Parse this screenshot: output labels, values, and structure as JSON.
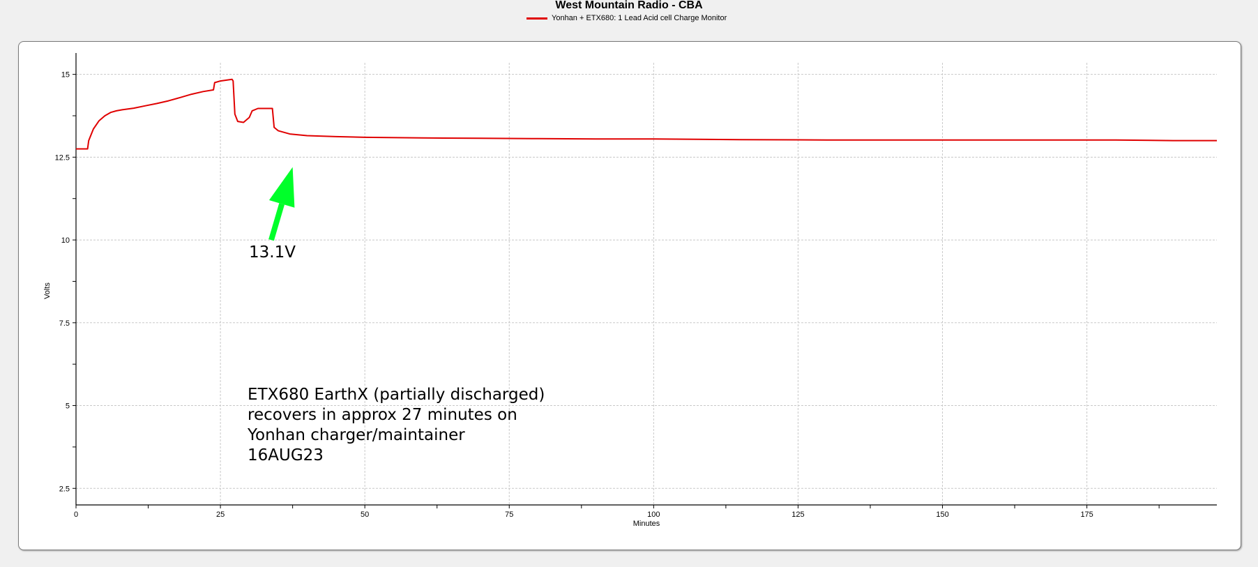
{
  "chart_data": {
    "type": "line",
    "title": "West Mountain Radio - CBA",
    "xlabel": "Minutes",
    "ylabel": "Volts",
    "xlim": [
      0,
      197.5
    ],
    "ylim": [
      2,
      15.35
    ],
    "x_ticks": [
      0,
      25,
      50,
      75,
      100,
      125,
      150,
      175
    ],
    "x_minor_step": 12.5,
    "y_ticks": [
      2.5,
      5,
      7.5,
      10,
      12.5,
      15
    ],
    "y_tick_labels": [
      "2.5",
      "5",
      "7.5",
      "10",
      "12.5",
      "15"
    ],
    "y_minor_step": 1.25,
    "grid": true,
    "legend_position": "top-center",
    "series": [
      {
        "name": "Yonhan + ETX680: 1 Lead Acid cell Charge Monitor",
        "color": "#e00000",
        "x": [
          0,
          2,
          2.2,
          3,
          4,
          5,
          6,
          7,
          8,
          10,
          12,
          14,
          16,
          18,
          20,
          22,
          23.8,
          24,
          25,
          27,
          27.2,
          27.5,
          28,
          29,
          30,
          30.5,
          31.5,
          32,
          34,
          34.3,
          35,
          37,
          40,
          45,
          50,
          60,
          70,
          80,
          90,
          100,
          115,
          130,
          150,
          170,
          180,
          190,
          197.5
        ],
        "y": [
          12.75,
          12.75,
          13.0,
          13.35,
          13.6,
          13.75,
          13.85,
          13.9,
          13.93,
          13.98,
          14.05,
          14.12,
          14.2,
          14.3,
          14.4,
          14.48,
          14.53,
          14.75,
          14.8,
          14.85,
          14.8,
          13.8,
          13.58,
          13.55,
          13.7,
          13.9,
          13.97,
          13.97,
          13.97,
          13.4,
          13.3,
          13.2,
          13.15,
          13.12,
          13.1,
          13.08,
          13.07,
          13.06,
          13.05,
          13.05,
          13.03,
          13.02,
          13.02,
          13.02,
          13.02,
          13.0,
          13.0
        ]
      }
    ],
    "annotations": {
      "arrow_label": "13.1V",
      "arrow_color": "#00ff2a",
      "arrow_from": [
        33.8,
        10.0
      ],
      "arrow_to": [
        37.5,
        12.2
      ],
      "note_lines": [
        "ETX680 EarthX (partially discharged)",
        "recovers in approx 27 minutes on",
        "Yonhan charger/maintainer",
        "16AUG23"
      ]
    }
  }
}
